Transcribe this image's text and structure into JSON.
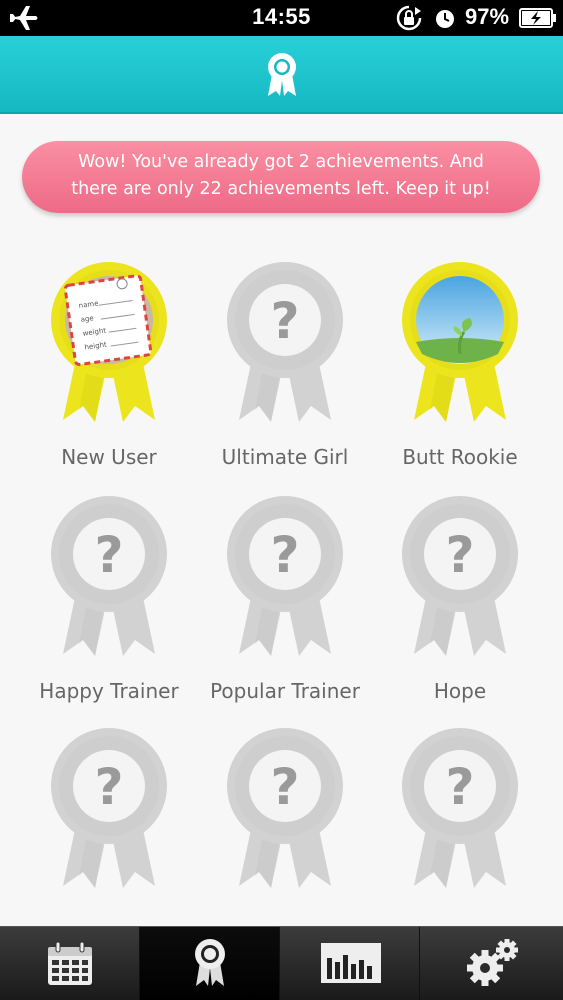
{
  "status_bar": {
    "time": "14:55",
    "battery_percent": "97%",
    "icons": [
      "airplane-icon",
      "rotation-lock-icon",
      "alarm-icon",
      "battery-charging-icon"
    ]
  },
  "header": {
    "icon": "ribbon-badge-icon",
    "accent_color": "#1cc3cc"
  },
  "banner": {
    "line1": "Wow! You've already got 2 achievements. And",
    "line2": "there are only 22 achievements left. Keep it up!",
    "color": "#f47a93"
  },
  "achievements": [
    {
      "name": "New User",
      "unlocked": true,
      "icon": "profile-card-icon"
    },
    {
      "name": "Ultimate Girl",
      "unlocked": false,
      "icon": "question-mark-icon"
    },
    {
      "name": "Butt Rookie",
      "unlocked": true,
      "icon": "sprout-icon"
    },
    {
      "name": "Happy Trainer",
      "unlocked": false,
      "icon": "question-mark-icon"
    },
    {
      "name": "Popular Trainer",
      "unlocked": false,
      "icon": "question-mark-icon"
    },
    {
      "name": "Hope",
      "unlocked": false,
      "icon": "question-mark-icon"
    },
    {
      "name": "",
      "unlocked": false,
      "icon": "question-mark-icon"
    },
    {
      "name": "",
      "unlocked": false,
      "icon": "question-mark-icon"
    },
    {
      "name": "",
      "unlocked": false,
      "icon": "question-mark-icon"
    }
  ],
  "badge_colors": {
    "unlocked": "#ece51d",
    "locked": "#d2d2d2"
  },
  "profile_card_fields": [
    "name",
    "age",
    "weight",
    "height"
  ],
  "tab_bar": {
    "tabs": [
      {
        "icon": "calendar-icon",
        "active": false
      },
      {
        "icon": "ribbon-badge-icon",
        "active": true
      },
      {
        "icon": "bar-chart-icon",
        "active": false
      },
      {
        "icon": "gears-icon",
        "active": false
      }
    ]
  }
}
